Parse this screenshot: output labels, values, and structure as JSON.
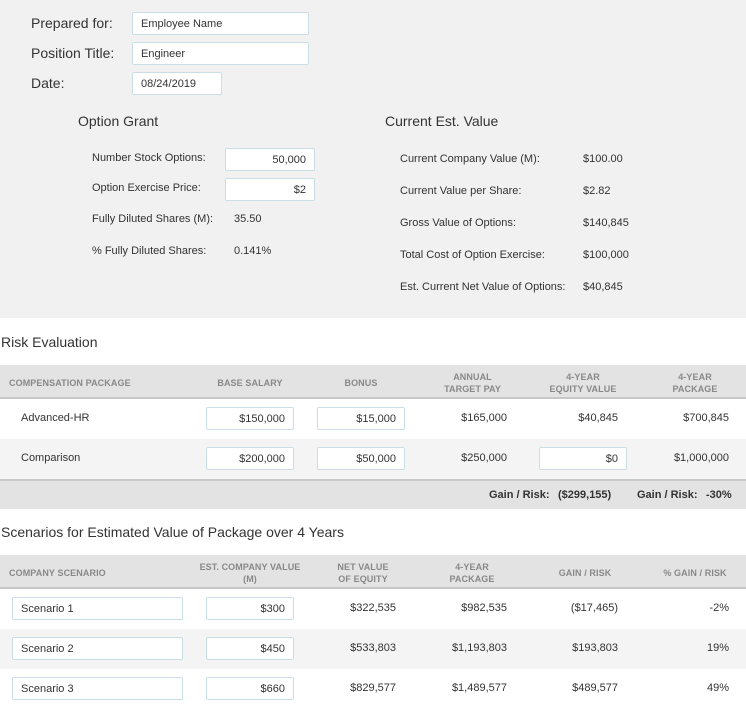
{
  "header": {
    "prepared_for": {
      "label": "Prepared for:",
      "value": "Employee Name"
    },
    "position_title": {
      "label": "Position Title:",
      "value": "Engineer"
    },
    "date": {
      "label": "Date:",
      "value": "08/24/2019"
    }
  },
  "option_grant": {
    "title": "Option Grant",
    "number_stock_options": {
      "label": "Number Stock Options:",
      "value": "50,000"
    },
    "option_exercise_price": {
      "label": "Option Exercise Price:",
      "value": "$2"
    },
    "fully_diluted_shares": {
      "label": "Fully Diluted Shares (M):",
      "value": "35.50"
    },
    "pct_fully_diluted": {
      "label": "% Fully Diluted Shares:",
      "value": "0.141%"
    }
  },
  "current_value": {
    "title": "Current Est. Value",
    "items": [
      {
        "label": "Current Company Value (M):",
        "value": "$100.00"
      },
      {
        "label": "Current Value per Share:",
        "value": "$2.82"
      },
      {
        "label": "Gross Value of Options:",
        "value": "$140,845"
      },
      {
        "label": "Total Cost of Option Exercise:",
        "value": "$100,000"
      },
      {
        "label": "Est. Current Net Value of Options:",
        "value": "$40,845"
      }
    ]
  },
  "risk": {
    "title": "Risk Evaluation",
    "columns": {
      "package": "COMPENSATION PACKAGE",
      "base": "BASE SALARY",
      "bonus": "BONUS",
      "annual_1": "ANNUAL",
      "annual_2": "TARGET PAY",
      "equity_1": "4-YEAR",
      "equity_2": "EQUITY VALUE",
      "pkg_1": "4-YEAR",
      "pkg_2": "PACKAGE"
    },
    "rows": [
      {
        "name": "Advanced-HR",
        "base": "$150,000",
        "bonus": "$15,000",
        "annual": "$165,000",
        "equity": "$40,845",
        "package": "$700,845"
      },
      {
        "name": "Comparison",
        "base": "$200,000",
        "bonus": "$50,000",
        "annual": "$250,000",
        "equity": "$0",
        "package": "$1,000,000"
      }
    ],
    "summary": {
      "gain_label_1": "Gain / Risk:",
      "gain_value": "($299,155)",
      "gain_label_2": "Gain / Risk:",
      "gain_pct": "-30%"
    }
  },
  "scenarios": {
    "title": "Scenarios for Estimated Value of Package over 4 Years",
    "columns": {
      "scenario": "COMPANY SCENARIO",
      "value_1": "EST. COMPANY VALUE",
      "value_2": "(M)",
      "net_1": "NET VALUE",
      "net_2": "OF EQUITY",
      "pkg_1": "4-YEAR",
      "pkg_2": "PACKAGE",
      "gain": "GAIN / RISK",
      "pct": "% GAIN / RISK"
    },
    "rows": [
      {
        "name": "Scenario 1",
        "value": "$300",
        "net": "$322,535",
        "package": "$982,535",
        "gain": "($17,465)",
        "pct": "-2%"
      },
      {
        "name": "Scenario 2",
        "value": "$450",
        "net": "$533,803",
        "package": "$1,193,803",
        "gain": "$193,803",
        "pct": "19%"
      },
      {
        "name": "Scenario 3",
        "value": "$660",
        "net": "$829,577",
        "package": "$1,489,577",
        "gain": "$489,577",
        "pct": "49%"
      }
    ]
  }
}
